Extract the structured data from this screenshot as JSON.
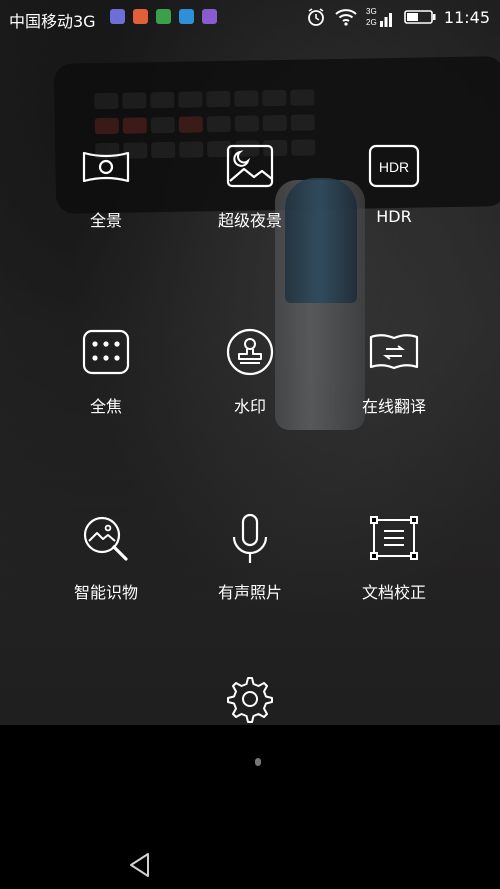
{
  "status_bar": {
    "carrier": "中国移动3G",
    "network_labels": [
      "3G",
      "2G"
    ],
    "time": "11:45",
    "app_icon_colors": [
      "#6d6fd6",
      "#e0603a",
      "#3aa14a",
      "#2f8fd8",
      "#8a5bd0"
    ]
  },
  "modes": [
    {
      "label": "全景",
      "icon": "panorama-icon"
    },
    {
      "label": "超级夜景",
      "icon": "night-scene-icon"
    },
    {
      "label": "HDR",
      "icon": "hdr-icon",
      "icon_text": "HDR"
    },
    {
      "label": "全焦",
      "icon": "all-focus-icon"
    },
    {
      "label": "水印",
      "icon": "watermark-stamp-icon"
    },
    {
      "label": "在线翻译",
      "icon": "translate-book-icon"
    },
    {
      "label": "智能识物",
      "icon": "object-recognition-icon"
    },
    {
      "label": "有声照片",
      "icon": "microphone-icon"
    },
    {
      "label": "文档校正",
      "icon": "document-correction-icon"
    }
  ],
  "settings": {
    "icon": "gear-icon"
  },
  "navigation": {
    "back_icon": "back-triangle-icon"
  }
}
